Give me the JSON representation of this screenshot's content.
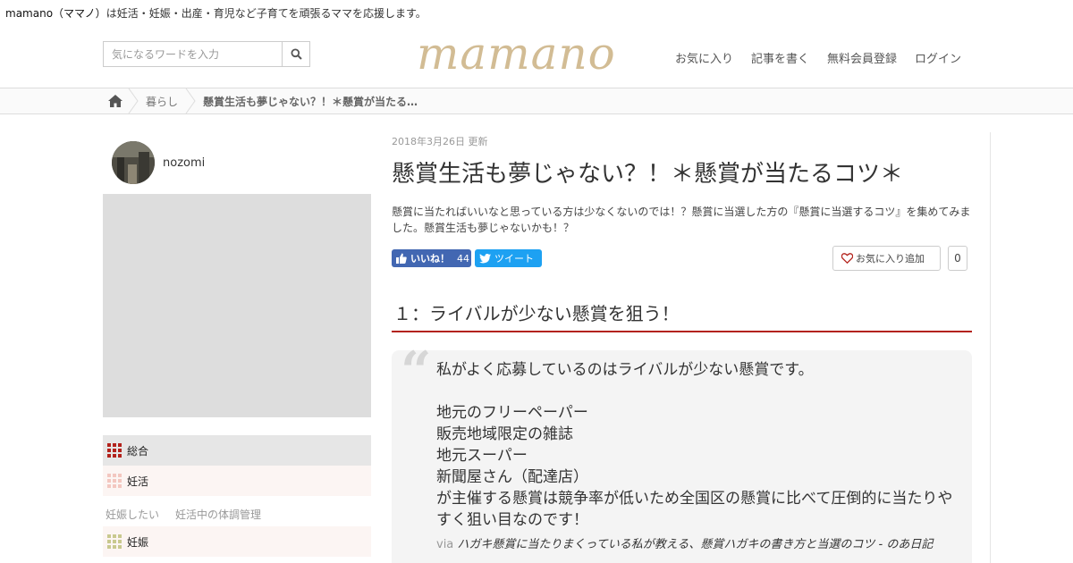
{
  "header": {
    "tagline_brand": "mamano（ママノ）",
    "tagline_rest": "は妊活・妊娠・出産・育児など子育てを頑張るママを応援します。",
    "search_placeholder": "気になるワードを入力",
    "logo": "mamano",
    "nav": [
      "お気に入り",
      "記事を書く",
      "無料会員登録",
      "ログイン"
    ]
  },
  "breadcrumb": {
    "home_icon": "home-icon",
    "items": [
      "暮らし",
      "懸賞生活も夢じゃない？！＊懸賞が当たる…"
    ]
  },
  "sidebar": {
    "author_name": "nozomi",
    "categories": [
      {
        "label": "総合",
        "color": "#b3221c"
      },
      {
        "label": "妊活",
        "color": "#f3c7c0"
      },
      {
        "label": "妊娠",
        "color": "#c9c98f"
      }
    ],
    "subcategories": [
      "妊娠したい",
      "妊活中の体調管理"
    ]
  },
  "article": {
    "updated": "2018年3月26日 更新",
    "title": "懸賞生活も夢じゃない？！＊懸賞が当たるコツ＊",
    "lead": "懸賞に当たればいいなと思っている方は少なくないのでは！？懸賞に当選した方の『懸賞に当選するコツ』を集めてみました。懸賞生活も夢じゃないかも！？",
    "fb_label": "いいね！",
    "fb_count": "44",
    "tweet_label": "ツイート",
    "fav_label": "お気に入り追加",
    "fav_count": "0",
    "section_heading": "１：ライバルが少ない懸賞を狙う！",
    "quote": {
      "first": "私がよく応募しているのはライバルが少ない懸賞です。",
      "lines": [
        "地元のフリーペーパー",
        "販売地域限定の雑誌",
        "地元スーパー",
        "新聞屋さん（配達店）",
        "が主催する懸賞は競争率が低いため全国区の懸賞に比べて圧倒的に当たりやすく狙い目なのです！"
      ],
      "via_label": "via",
      "source": "ハガキ懸賞に当たりまくっている私が教える、懸賞ハガキの書き方と当選のコツ - のあ日記"
    }
  },
  "colors": {
    "accent_red": "#b3221c",
    "logo": "#d2bc94",
    "facebook": "#4267b2",
    "twitter": "#1da1f2"
  }
}
